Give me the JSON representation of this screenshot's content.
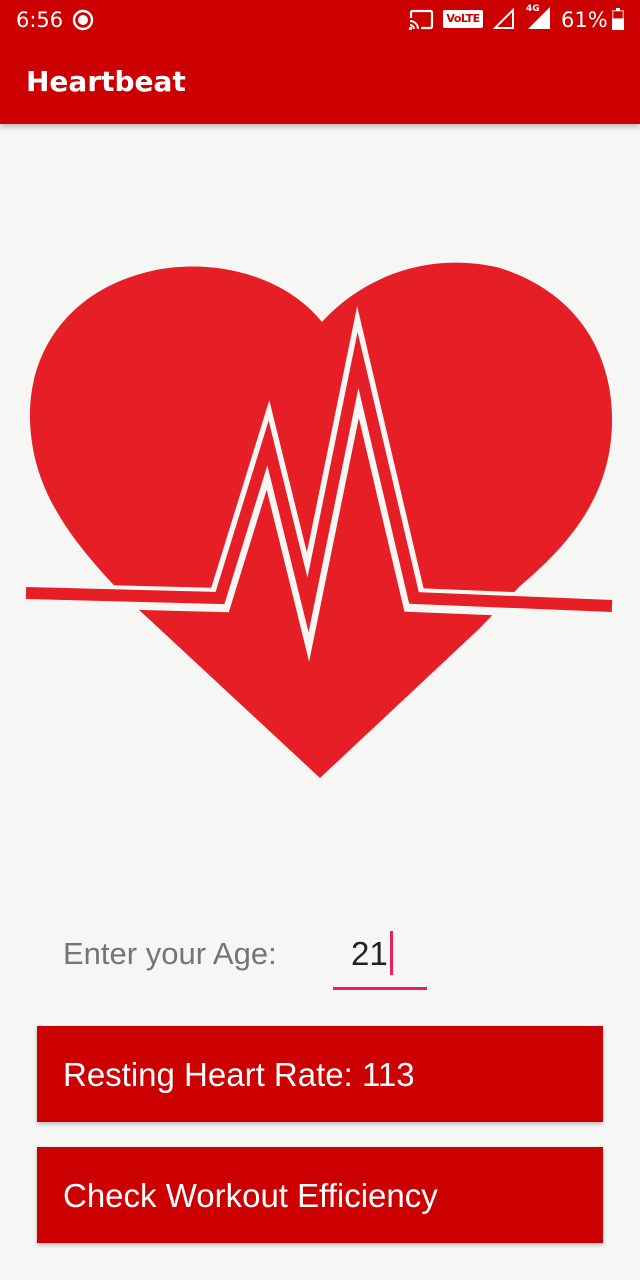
{
  "status_bar": {
    "time": "6:56",
    "network_badge": "VoLTE",
    "network_type": "4G",
    "battery_percent": "61%",
    "battery_level": 0.61,
    "icons": [
      "record-icon",
      "cast-icon",
      "volte-icon",
      "signal-icon",
      "signal-4g-icon",
      "battery-icon"
    ]
  },
  "app_bar": {
    "title": "Heartbeat"
  },
  "hero": {
    "icon": "heartbeat-icon",
    "heart_color": "#e61f26"
  },
  "form": {
    "age_label": "Enter your Age:",
    "age_value": "21"
  },
  "buttons": {
    "resting_heart_rate": "Resting Heart Rate:  113",
    "check_workout": "Check Workout Efficiency"
  },
  "colors": {
    "primary": "#cc0000",
    "accent": "#e91e63",
    "background": "#f6f7f5"
  }
}
